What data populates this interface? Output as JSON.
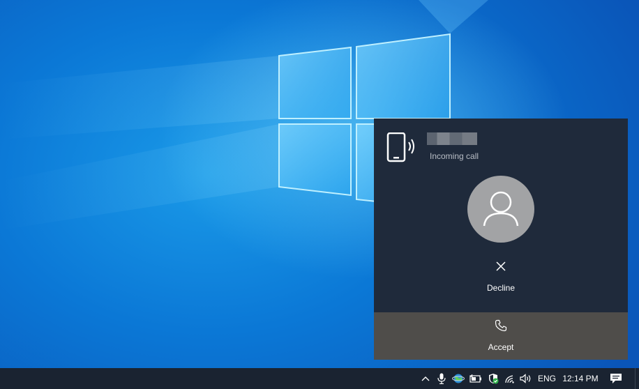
{
  "notification": {
    "caller_name": "",
    "status": "Incoming call",
    "decline_label": "Decline",
    "accept_label": "Accept",
    "icons": {
      "app": "phone-ringing-icon",
      "avatar": "person-icon",
      "decline": "close-icon",
      "accept": "phone-icon"
    }
  },
  "taskbar": {
    "tray_icons": [
      "chevron-up-icon",
      "microphone-icon",
      "network-globe-icon",
      "battery-icon",
      "windows-security-icon",
      "wifi-icon",
      "volume-icon",
      "action-center-icon"
    ],
    "language": "ENG",
    "time": "12:14 PM"
  },
  "colors": {
    "toast_background": "#1f2a3b",
    "accept_background": "#4f4d4a",
    "taskbar_background": "#1a2331",
    "desktop_blue": "#0b78d6"
  }
}
